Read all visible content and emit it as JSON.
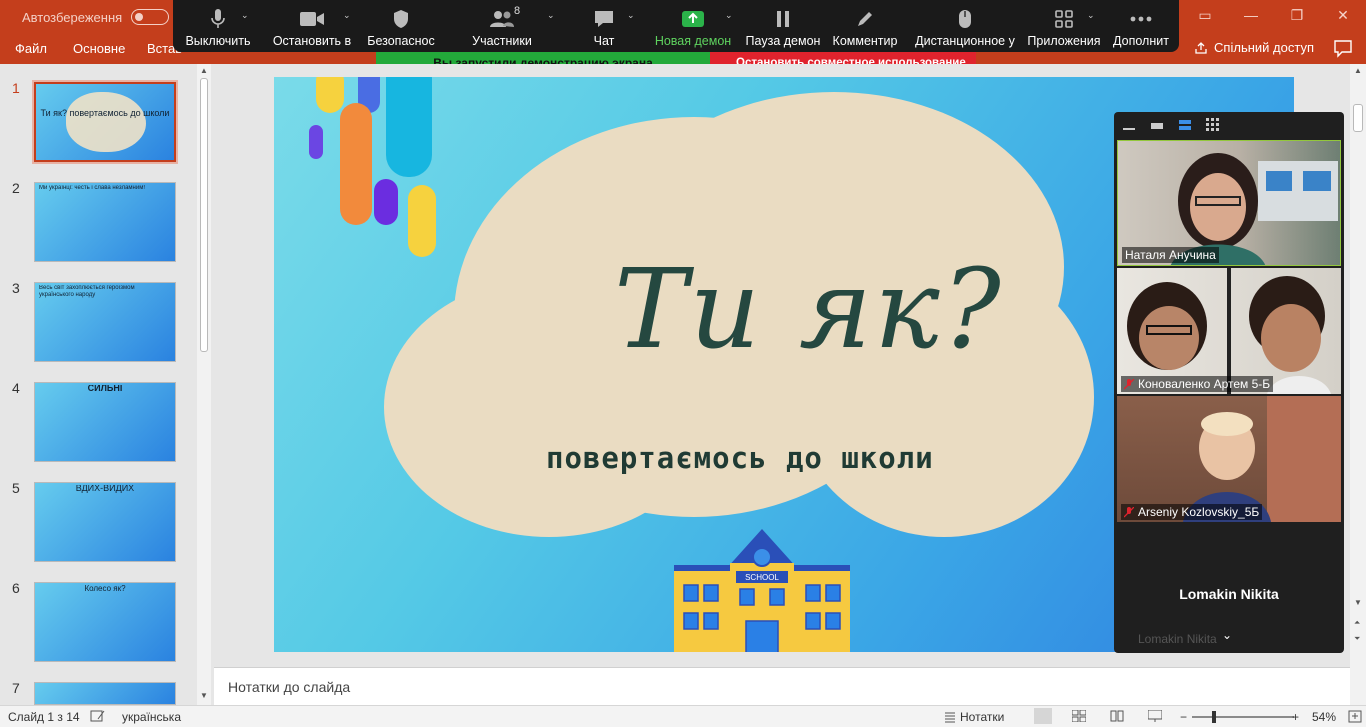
{
  "ppt": {
    "autosave_label": "Автозбереження",
    "ribbon_tabs": [
      "Файл",
      "Основне",
      "Встав"
    ],
    "share_label": "Спільний доступ"
  },
  "zoom": {
    "buttons": [
      {
        "label": "Выключить",
        "icon": "microphone-icon"
      },
      {
        "label": "Остановить в",
        "icon": "video-camera-icon"
      },
      {
        "label": "Безопаснос",
        "icon": "shield-icon"
      },
      {
        "label": "Участники",
        "icon": "participants-icon",
        "count": "8"
      },
      {
        "label": "Чат",
        "icon": "chat-icon"
      },
      {
        "label": "Новая демон",
        "icon": "share-screen-icon"
      },
      {
        "label": "Пауза демон",
        "icon": "pause-icon"
      },
      {
        "label": "Комментир",
        "icon": "pen-icon"
      },
      {
        "label": "Дистанционное у",
        "icon": "mouse-icon"
      },
      {
        "label": "Приложения",
        "icon": "apps-icon"
      },
      {
        "label": "Дополнит",
        "icon": "more-icon"
      }
    ],
    "share_banner": "Вы запустили демонстрацию экрана",
    "stop_banner": "Остановить совместное использование",
    "accent": "#23a93a",
    "stop_color": "#e0232d"
  },
  "slides_pane": {
    "numbers": [
      "1",
      "2",
      "3",
      "4",
      "5",
      "6",
      "7"
    ],
    "thumb_texts": [
      "Ти як?\nповертаємось до школи",
      "Ми українці: честь і слава незламним!",
      "Весь світ захоплюється героїзмом українського народу",
      "СИЛЬНІ",
      "ВДИХ-ВИДИХ",
      "Колесо як?",
      ""
    ]
  },
  "slide": {
    "title": "Ти як?",
    "subtitle": "повертаємось до школи",
    "school_sign": "SCHOOL"
  },
  "notes": {
    "placeholder": "Нотатки до слайда"
  },
  "status": {
    "slide_info": "Слайд 1 з 14",
    "language": "українська",
    "notes_label": "Нотатки",
    "zoom_level": "54%"
  },
  "gallery": {
    "tiles": [
      {
        "name": "Наталя Анучина",
        "muted": false
      },
      {
        "name": "Коноваленко Артем 5-Б",
        "muted": true
      },
      {
        "name": "Arseniy Kozlovskiy_5Б",
        "muted": true
      }
    ],
    "name_only": "Lomakin Nikita",
    "name_ghost": "Lomakin Nikita"
  }
}
